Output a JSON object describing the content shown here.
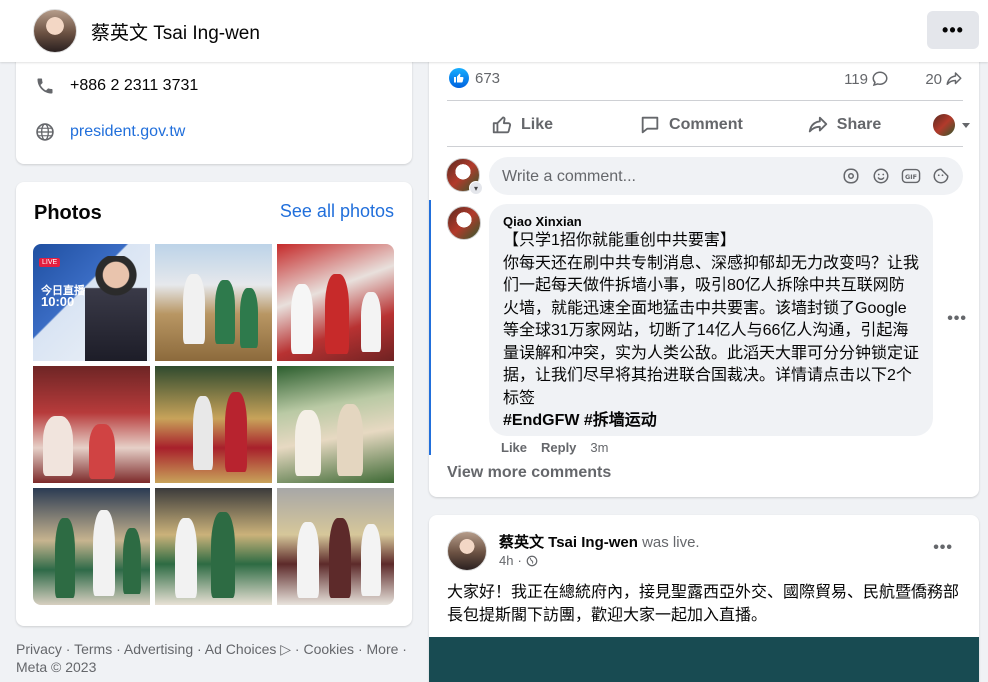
{
  "header": {
    "name": "蔡英文 Tsai Ing-wen",
    "more_label": "•••"
  },
  "contact": {
    "phone": "+886 2 2311 3731",
    "website": "president.gov.tw"
  },
  "photos": {
    "title": "Photos",
    "see_all": "See all photos",
    "photo1_live": "LIVE",
    "photo1_line1": "今日直播",
    "photo1_line2": "10:00"
  },
  "footer": {
    "links": "Privacy · Terms · Advertising · Ad Choices ▷ · Cookies · More ·",
    "copyright": "Meta © 2023"
  },
  "post": {
    "reactions_count": "673",
    "comments_count": "119",
    "shares_count": "20",
    "like_label": "Like",
    "comment_label": "Comment",
    "share_label": "Share",
    "composer_placeholder": "Write a comment...",
    "comment": {
      "author": "Qiao Xinxian",
      "body": "【只学1招你就能重创中共要害】\n你每天还在刷中共专制消息、深感抑郁却无力改变吗？让我们一起每天做件拆墙小事，吸引80亿人拆除中共互联网防火墙，就能迅速全面地猛击中共要害。该墙封锁了Google等全球31万家网站，切断了14亿人与66亿人沟通，引起海量误解和冲突，实为人类公敌。此滔天大罪可分分钟锁定证据，让我们尽早将其抬进联合国裁决。详情请点击以下2个标签",
      "tags": "#EndGFW #拆墙运动",
      "like": "Like",
      "reply": "Reply",
      "time": "3m"
    },
    "view_more": "View more comments"
  },
  "post2": {
    "author": "蔡英文 Tsai Ing-wen",
    "action": "was live.",
    "time": "4h",
    "text": "大家好！我正在總統府內，接見聖露西亞外交、國際貿易、民航暨僑務部長包提斯閣下訪團，歡迎大家一起加入直播。"
  },
  "colors": {
    "accent": "#216fdb",
    "like_blue": "#0062df",
    "thread_line": "#216fdb",
    "media_bg": "#184b52"
  }
}
